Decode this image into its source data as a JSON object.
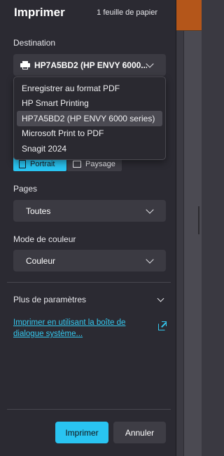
{
  "dialog": {
    "title": "Imprimer",
    "sheet_count": "1 feuille de papier"
  },
  "destination": {
    "label": "Destination",
    "selected": "HP7A5BD2 (HP ENVY 6000...",
    "icon": "printer-icon",
    "options": [
      {
        "label": "Enregistrer au format PDF",
        "selected": false
      },
      {
        "label": "HP Smart Printing",
        "selected": false
      },
      {
        "label": "HP7A5BD2 (HP ENVY 6000 series)",
        "selected": true
      },
      {
        "label": "Microsoft Print to PDF",
        "selected": false
      },
      {
        "label": "Snagit 2024",
        "selected": false
      }
    ]
  },
  "orientation": {
    "portrait": "Portrait",
    "landscape": "Paysage",
    "selected": "Portrait"
  },
  "pages": {
    "label": "Pages",
    "value": "Toutes"
  },
  "color_mode": {
    "label": "Mode de couleur",
    "value": "Couleur"
  },
  "more_settings": {
    "label": "Plus de paramètres"
  },
  "system_dialog_link": "Imprimer en utilisant la boîte de dialogue système...",
  "buttons": {
    "print": "Imprimer",
    "cancel": "Annuler"
  },
  "colors": {
    "accent": "#29c4f1",
    "panel_bg": "#2b2a32",
    "control_bg": "#3b3a42",
    "link": "#35c8ef",
    "page_header": "#b4561a"
  }
}
